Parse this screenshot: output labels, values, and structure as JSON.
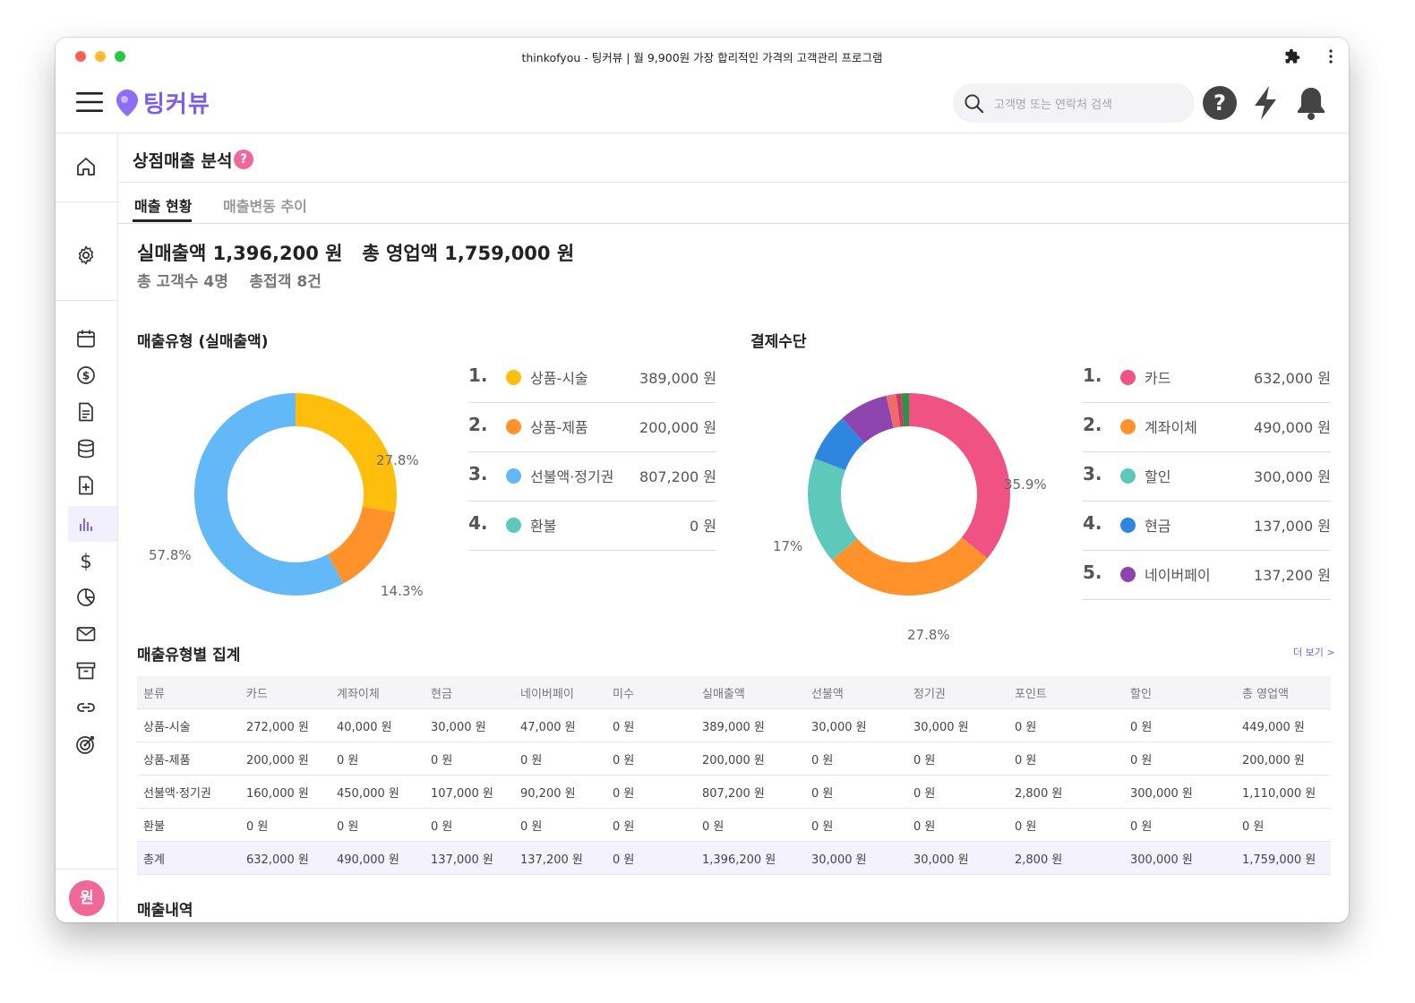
{
  "window": {
    "title": "thinkofyou - 팅커뷰 | 월 9,900원 가장 합리적인 가격의 고객관리 프로그램"
  },
  "header": {
    "logo_text": "팅커뷰",
    "search_placeholder": "고객명 또는 연락처 검색"
  },
  "page": {
    "title": "상점매출 분석",
    "help": "?",
    "tabs": [
      "매출 현황",
      "매출변동 추이"
    ]
  },
  "summary": {
    "line1": "실매출액 1,396,200 원   총 영업액 1,759,000 원",
    "line2": "총 고객수 4명    총접객 8건"
  },
  "sales_type": {
    "title": "매출유형 (실매출액)",
    "pct_labels": [
      "27.8%",
      "14.3%",
      "57.8%"
    ],
    "items": [
      {
        "rank": "1.",
        "name": "상품-시술",
        "value": "389,000 원",
        "color": "#ffbe0b"
      },
      {
        "rank": "2.",
        "name": "상품-제품",
        "value": "200,000 원",
        "color": "#ff922b"
      },
      {
        "rank": "3.",
        "name": "선불액·정기권",
        "value": "807,200 원",
        "color": "#63b8f7"
      },
      {
        "rank": "4.",
        "name": "환불",
        "value": "0 원",
        "color": "#5ec8bb"
      }
    ]
  },
  "payment": {
    "title": "결제수단",
    "pct_labels": [
      "35.9%",
      "27.8%",
      "17%"
    ],
    "items": [
      {
        "rank": "1.",
        "name": "카드",
        "value": "632,000 원",
        "color": "#ef5283"
      },
      {
        "rank": "2.",
        "name": "계좌이체",
        "value": "490,000 원",
        "color": "#ff922b"
      },
      {
        "rank": "3.",
        "name": "할인",
        "value": "300,000 원",
        "color": "#5ec8bb"
      },
      {
        "rank": "4.",
        "name": "현금",
        "value": "137,000 원",
        "color": "#2e86de"
      },
      {
        "rank": "5.",
        "name": "네이버페이",
        "value": "137,200 원",
        "color": "#8e44ad"
      }
    ],
    "more": "더 보기 >"
  },
  "chart_data": [
    {
      "type": "pie",
      "donut": true,
      "categories": [
        "상품-시술",
        "상품-제품",
        "선불액·정기권",
        "환불"
      ],
      "values": [
        389000,
        200000,
        807200,
        0
      ],
      "percent_labels": [
        "27.8%",
        "14.3%",
        "57.8%"
      ],
      "colors": [
        "#ffbe0b",
        "#ff922b",
        "#63b8f7",
        "#5ec8bb"
      ]
    },
    {
      "type": "pie",
      "donut": true,
      "categories": [
        "카드",
        "계좌이체",
        "할인",
        "현금",
        "네이버페이"
      ],
      "values": [
        632000,
        490000,
        300000,
        137000,
        137200,
        28000,
        14000,
        22000
      ],
      "percent_labels": [
        "35.9%",
        "27.8%",
        "17%"
      ],
      "colors": [
        "#ef5283",
        "#ff922b",
        "#5ec8bb",
        "#2e86de",
        "#8e44ad",
        "#ee6b6b",
        "#d6336c",
        "#2b9348"
      ]
    }
  ],
  "aggregate": {
    "title": "매출유형별 집계",
    "headers": [
      "분류",
      "카드",
      "계좌이체",
      "현금",
      "네이버페이",
      "미수",
      "실매출액",
      "선불액",
      "정기권",
      "포인트",
      "할인",
      "총 영업액"
    ],
    "rows": [
      [
        "상품-시술",
        "272,000 원",
        "40,000 원",
        "30,000 원",
        "47,000 원",
        "0 원",
        "389,000 원",
        "30,000 원",
        "30,000 원",
        "0 원",
        "0 원",
        "449,000 원"
      ],
      [
        "상품-제품",
        "200,000 원",
        "0 원",
        "0 원",
        "0 원",
        "0 원",
        "200,000 원",
        "0 원",
        "0 원",
        "0 원",
        "0 원",
        "200,000 원"
      ],
      [
        "선불액·정기권",
        "160,000 원",
        "450,000 원",
        "107,000 원",
        "90,200 원",
        "0 원",
        "807,200 원",
        "0 원",
        "0 원",
        "2,800 원",
        "300,000 원",
        "1,110,000 원"
      ],
      [
        "환불",
        "0 원",
        "0 원",
        "0 원",
        "0 원",
        "0 원",
        "0 원",
        "0 원",
        "0 원",
        "0 원",
        "0 원",
        "0 원"
      ]
    ],
    "total": [
      "총계",
      "632,000 원",
      "490,000 원",
      "137,000 원",
      "137,200 원",
      "0 원",
      "1,396,200 원",
      "30,000 원",
      "30,000 원",
      "2,800 원",
      "300,000 원",
      "1,759,000 원"
    ]
  },
  "bottom": {
    "title": "매출내역"
  },
  "user": {
    "avatar_letter": "원"
  },
  "icons": [
    "menu-icon",
    "location-pin-icon",
    "search-icon",
    "help-icon",
    "lightning-icon",
    "bell-icon",
    "extension-icon",
    "more-vertical-icon",
    "home-icon",
    "settings-icon",
    "calendar-icon",
    "coin-icon",
    "document-icon",
    "database-icon",
    "file-plus-icon",
    "bar-chart-icon",
    "dollar-icon",
    "pie-chart-icon",
    "mail-icon",
    "archive-icon",
    "link-icon",
    "target-icon",
    "chatbot-icon"
  ]
}
